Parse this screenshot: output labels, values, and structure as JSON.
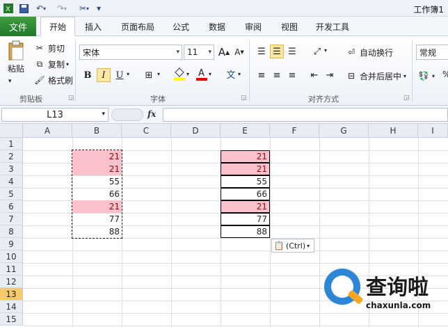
{
  "window": {
    "title": "工作簿1"
  },
  "qat": {
    "save_icon": "save-icon",
    "undo_icon": "undo-icon",
    "redo_icon": "redo-icon",
    "tools_icon": "tools-icon"
  },
  "tabs": {
    "file": "文件",
    "items": [
      "开始",
      "插入",
      "页面布局",
      "公式",
      "数据",
      "审阅",
      "视图",
      "开发工具"
    ],
    "active": "开始"
  },
  "clipboard": {
    "paste": "粘贴",
    "cut": "剪切",
    "copy": "复制",
    "format_painter": "格式刷",
    "label": "剪贴板"
  },
  "font": {
    "name": "宋体",
    "size": "11",
    "bold": "B",
    "italic": "I",
    "underline": "U",
    "label": "字体",
    "wen": "文",
    "grow": "A",
    "shrink": "A"
  },
  "alignment": {
    "wrap": "自动换行",
    "merge": "合并后居中",
    "label": "对齐方式"
  },
  "number": {
    "format": "常规"
  },
  "formula_bar": {
    "name_box": "L13",
    "fx": "fx"
  },
  "columns": [
    "A",
    "B",
    "C",
    "D",
    "E",
    "F",
    "G",
    "H",
    "I"
  ],
  "rows": [
    "1",
    "2",
    "3",
    "4",
    "5",
    "6",
    "7",
    "8",
    "9",
    "10",
    "11",
    "12",
    "13",
    "14",
    "15"
  ],
  "selected_row": "13",
  "column_b": [
    "21",
    "21",
    "55",
    "66",
    "21",
    "77",
    "88"
  ],
  "column_e": [
    "21",
    "21",
    "55",
    "66",
    "21",
    "77",
    "88"
  ],
  "paste_options": {
    "label": "(Ctrl)"
  },
  "watermark": {
    "brand": "查询啦",
    "url": "chaxunla.com"
  },
  "colors": {
    "file_tab": "#2a8a33",
    "highlight_fill": "#fbc2cb",
    "highlight_text": "#9c0006",
    "selected_row": "#f7c96b"
  }
}
